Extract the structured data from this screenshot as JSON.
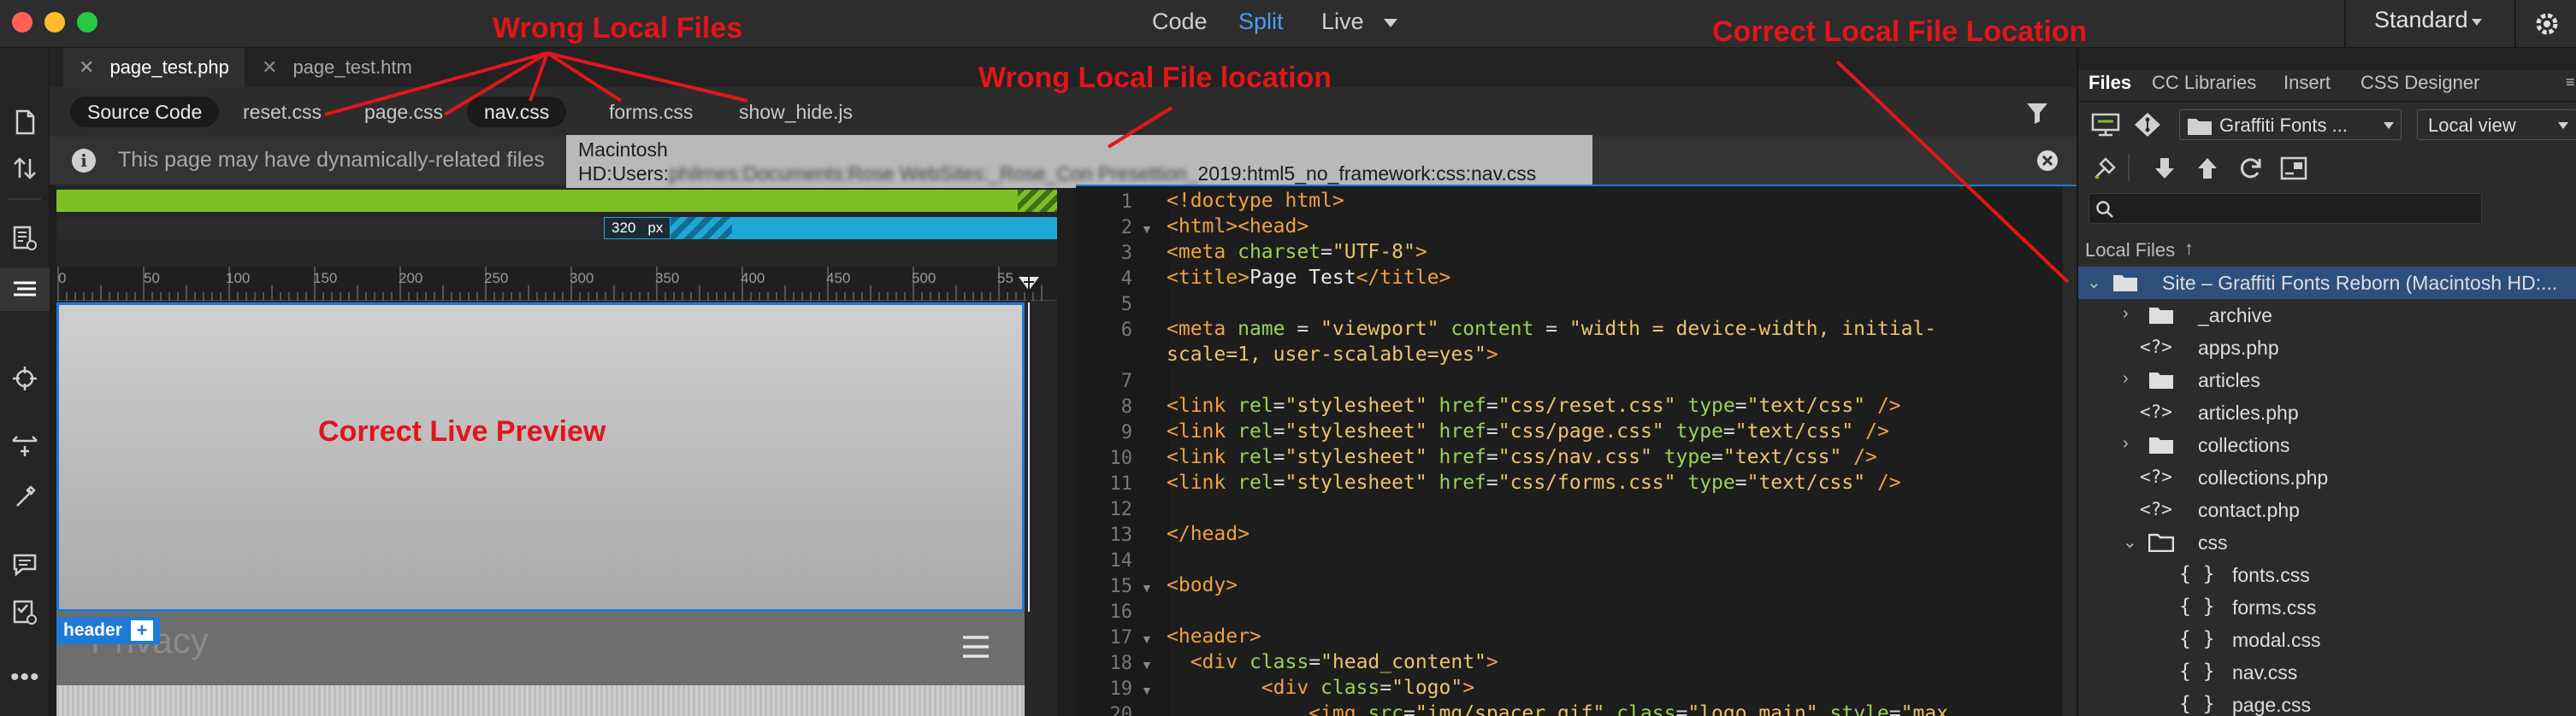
{
  "titlebar": {
    "view_modes": [
      "Code",
      "Split",
      "Live"
    ],
    "active_mode": "Split",
    "workspace": "Standard"
  },
  "document_tabs": [
    "page_test.php",
    "page_test.htm"
  ],
  "related_files": [
    "Source Code",
    "reset.css",
    "page.css",
    "nav.css",
    "forms.css",
    "show_hide.js"
  ],
  "info_bar": {
    "message": "This page may have dynamically-related files"
  },
  "tooltip": {
    "line1": "Macintosh",
    "line2": "HD:Users:",
    "line2_blurred": "philrnes:Documents:Rose WebSites:_Rose_Con Presettion_",
    "line2_tail": "2019:html5_no_framework:css:nav.css"
  },
  "live_view": {
    "width_badge": "320",
    "width_unit": "px",
    "ruler_ticks": [
      "0",
      "50",
      "100",
      "150",
      "200",
      "250",
      "300",
      "350",
      "400",
      "450",
      "500",
      "55"
    ],
    "element_tag": "header",
    "element_add": "+",
    "preview_text": "Privacy"
  },
  "code_lines": [
    {
      "n": "1",
      "fold": "",
      "parts": [
        [
          "<!doctype html>",
          "#f0a142"
        ]
      ]
    },
    {
      "n": "2",
      "fold": "▼",
      "parts": [
        [
          "<html><head>",
          "#f0a142"
        ]
      ]
    },
    {
      "n": "3",
      "fold": "",
      "parts": [
        [
          "<meta ",
          "#f0a142"
        ],
        [
          "charset",
          "#9bd15a"
        ],
        [
          "=",
          "#d6d6d6"
        ],
        [
          "\"UTF-8\"",
          "#e9c46a"
        ],
        [
          ">",
          "#f0a142"
        ]
      ]
    },
    {
      "n": "4",
      "fold": "",
      "parts": [
        [
          "<title>",
          "#f0a142"
        ],
        [
          "Page Test",
          "#e6e6e6"
        ],
        [
          "</title>",
          "#f0a142"
        ]
      ]
    },
    {
      "n": "5",
      "fold": "",
      "parts": []
    },
    {
      "n": "6",
      "fold": "",
      "parts": [
        [
          "<meta ",
          "#f0a142"
        ],
        [
          "name",
          "#9bd15a"
        ],
        [
          " = ",
          "#d6d6d6"
        ],
        [
          "\"viewport\"",
          "#e9c46a"
        ],
        [
          " content",
          "#9bd15a"
        ],
        [
          " = ",
          "#d6d6d6"
        ],
        [
          "\"width = device-width, initial-",
          "#e9c46a"
        ]
      ]
    },
    {
      "n": "",
      "fold": "",
      "parts": [
        [
          "scale=1, user-scalable=yes\"",
          "#e9c46a"
        ],
        [
          ">",
          "#f0a142"
        ]
      ]
    },
    {
      "n": "7",
      "fold": "",
      "parts": []
    },
    {
      "n": "8",
      "fold": "",
      "parts": [
        [
          "<link ",
          "#f0a142"
        ],
        [
          "rel",
          "#9bd15a"
        ],
        [
          "=",
          "#d6d6d6"
        ],
        [
          "\"stylesheet\"",
          "#e9c46a"
        ],
        [
          " href",
          "#9bd15a"
        ],
        [
          "=",
          "#d6d6d6"
        ],
        [
          "\"css/reset.css\"",
          "#e9c46a"
        ],
        [
          " type",
          "#9bd15a"
        ],
        [
          "=",
          "#d6d6d6"
        ],
        [
          "\"text/css\"",
          "#e9c46a"
        ],
        [
          " />",
          "#f0a142"
        ]
      ]
    },
    {
      "n": "9",
      "fold": "",
      "parts": [
        [
          "<link ",
          "#f0a142"
        ],
        [
          "rel",
          "#9bd15a"
        ],
        [
          "=",
          "#d6d6d6"
        ],
        [
          "\"stylesheet\"",
          "#e9c46a"
        ],
        [
          " href",
          "#9bd15a"
        ],
        [
          "=",
          "#d6d6d6"
        ],
        [
          "\"css/page.css\"",
          "#e9c46a"
        ],
        [
          " type",
          "#9bd15a"
        ],
        [
          "=",
          "#d6d6d6"
        ],
        [
          "\"text/css\"",
          "#e9c46a"
        ],
        [
          " />",
          "#f0a142"
        ]
      ]
    },
    {
      "n": "10",
      "fold": "",
      "parts": [
        [
          "<link ",
          "#f0a142"
        ],
        [
          "rel",
          "#9bd15a"
        ],
        [
          "=",
          "#d6d6d6"
        ],
        [
          "\"stylesheet\"",
          "#e9c46a"
        ],
        [
          " href",
          "#9bd15a"
        ],
        [
          "=",
          "#d6d6d6"
        ],
        [
          "\"css/nav.css\"",
          "#e9c46a"
        ],
        [
          " type",
          "#9bd15a"
        ],
        [
          "=",
          "#d6d6d6"
        ],
        [
          "\"text/css\"",
          "#e9c46a"
        ],
        [
          " />",
          "#f0a142"
        ]
      ]
    },
    {
      "n": "11",
      "fold": "",
      "parts": [
        [
          "<link ",
          "#f0a142"
        ],
        [
          "rel",
          "#9bd15a"
        ],
        [
          "=",
          "#d6d6d6"
        ],
        [
          "\"stylesheet\"",
          "#e9c46a"
        ],
        [
          " href",
          "#9bd15a"
        ],
        [
          "=",
          "#d6d6d6"
        ],
        [
          "\"css/forms.css\"",
          "#e9c46a"
        ],
        [
          " type",
          "#9bd15a"
        ],
        [
          "=",
          "#d6d6d6"
        ],
        [
          "\"text/css\"",
          "#e9c46a"
        ],
        [
          " />",
          "#f0a142"
        ]
      ]
    },
    {
      "n": "12",
      "fold": "",
      "parts": []
    },
    {
      "n": "13",
      "fold": "",
      "parts": [
        [
          "</head>",
          "#f0a142"
        ]
      ]
    },
    {
      "n": "14",
      "fold": "",
      "parts": []
    },
    {
      "n": "15",
      "fold": "▼",
      "parts": [
        [
          "<body>",
          "#f0a142"
        ]
      ]
    },
    {
      "n": "16",
      "fold": "",
      "parts": []
    },
    {
      "n": "17",
      "fold": "▼",
      "parts": [
        [
          "<header>",
          "#f0a142"
        ]
      ]
    },
    {
      "n": "18",
      "fold": "▼",
      "parts": [
        [
          "  <div ",
          "#f0a142"
        ],
        [
          "class",
          "#9bd15a"
        ],
        [
          "=",
          "#d6d6d6"
        ],
        [
          "\"head_content\"",
          "#e9c46a"
        ],
        [
          ">",
          "#f0a142"
        ]
      ]
    },
    {
      "n": "19",
      "fold": "▼",
      "parts": [
        [
          "        <div ",
          "#f0a142"
        ],
        [
          "class",
          "#9bd15a"
        ],
        [
          "=",
          "#d6d6d6"
        ],
        [
          "\"logo\"",
          "#e9c46a"
        ],
        [
          ">",
          "#f0a142"
        ]
      ]
    },
    {
      "n": "20",
      "fold": "",
      "parts": [
        [
          "            <img ",
          "#f0a142"
        ],
        [
          "src",
          "#9bd15a"
        ],
        [
          "=",
          "#d6d6d6"
        ],
        [
          "\"img/spacer.gif\"",
          "#e9c46a"
        ],
        [
          " class",
          "#9bd15a"
        ],
        [
          "=",
          "#d6d6d6"
        ],
        [
          "\"logo_main\"",
          "#e9c46a"
        ],
        [
          " style",
          "#9bd15a"
        ],
        [
          "=",
          "#d6d6d6"
        ],
        [
          "\"max",
          "#e9c46a"
        ]
      ]
    }
  ],
  "files_panel": {
    "tabs": [
      "Files",
      "CC Libraries",
      "Insert",
      "CSS Designer"
    ],
    "site_dropdown": "Graffiti Fonts ...",
    "view_dropdown": "Local view",
    "search_placeholder": "",
    "local_files_label": "Local Files",
    "sort_arrow": "↑",
    "tree": [
      {
        "type": "site",
        "name": "Site – Graffiti Fonts Reborn (Macintosh HD:..."
      },
      {
        "type": "folder",
        "name": "_archive",
        "expanded": false
      },
      {
        "type": "php",
        "name": "apps.php"
      },
      {
        "type": "folder",
        "name": "articles",
        "expanded": false
      },
      {
        "type": "php",
        "name": "articles.php"
      },
      {
        "type": "folder",
        "name": "collections",
        "expanded": false
      },
      {
        "type": "php",
        "name": "collections.php"
      },
      {
        "type": "php",
        "name": "contact.php"
      },
      {
        "type": "folder",
        "name": "css",
        "expanded": true
      },
      {
        "type": "css",
        "name": "fonts.css"
      },
      {
        "type": "css",
        "name": "forms.css"
      },
      {
        "type": "css",
        "name": "modal.css"
      },
      {
        "type": "css",
        "name": "nav.css"
      },
      {
        "type": "css",
        "name": "page.css"
      }
    ]
  },
  "annotations": {
    "wrong_local_files": "Wrong Local Files",
    "wrong_local_file_location": "Wrong Local File location",
    "correct_local_file_location": "Correct Local File Location",
    "correct_live_preview": "Correct Live Preview"
  },
  "colors": {
    "accent_blue": "#4a9ff0",
    "annotation_red": "#e0161b",
    "live_green": "#7cbf24",
    "live_cyan": "#1fa8d6"
  }
}
